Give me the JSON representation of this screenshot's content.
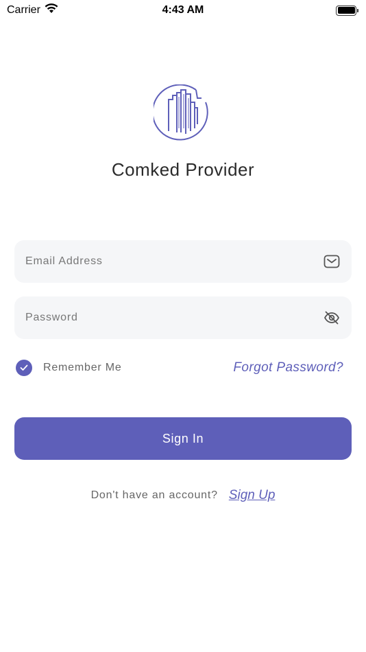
{
  "status_bar": {
    "carrier": "Carrier",
    "time": "4:43 AM"
  },
  "app": {
    "title": "Comked Provider"
  },
  "login_form": {
    "email_placeholder": "Email Address",
    "password_placeholder": "Password",
    "remember_me_label": "Remember Me",
    "remember_me_checked": true,
    "forgot_password_label": "Forgot Password?",
    "sign_in_label": "Sign In",
    "signup_prompt": "Don't have an account?",
    "signup_label": "Sign Up"
  },
  "icons": {
    "logo": "city-buildings-logo",
    "email": "mail-icon",
    "password": "eye-off-icon",
    "checkbox": "checkmark-icon"
  },
  "colors": {
    "accent": "#5e5fb9",
    "field_background": "#f5f6f8",
    "title_text": "#2b2b2b",
    "muted_text": "#666666"
  }
}
